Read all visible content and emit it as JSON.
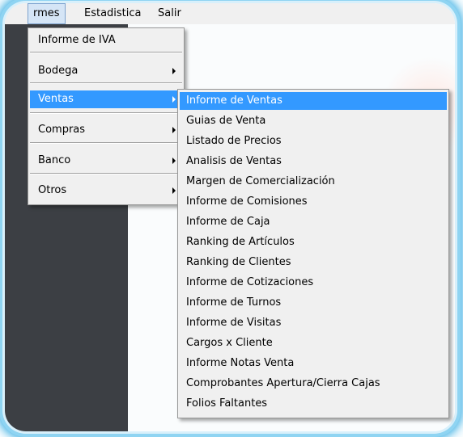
{
  "menubar": {
    "items": [
      "rmes",
      "Estadistica",
      "Salir"
    ]
  },
  "main_menu": {
    "items": [
      {
        "label": "Informe de IVA",
        "submenu": false
      },
      {
        "label": "Bodega",
        "submenu": true
      },
      {
        "label": "Ventas",
        "submenu": true,
        "highlighted": true
      },
      {
        "label": "Compras",
        "submenu": true
      },
      {
        "label": "Banco",
        "submenu": true
      },
      {
        "label": "Otros",
        "submenu": true
      }
    ]
  },
  "submenu": {
    "items": [
      {
        "label": "Informe de Ventas",
        "highlighted": true
      },
      {
        "label": "Guias de Venta"
      },
      {
        "label": "Listado de Precios"
      },
      {
        "label": "Analisis de Ventas"
      },
      {
        "label": "Margen de Comercialización"
      },
      {
        "label": "Informe de Comisiones"
      },
      {
        "label": "Informe de Caja"
      },
      {
        "label": "Ranking de Artículos"
      },
      {
        "label": "Ranking de Clientes"
      },
      {
        "label": "Informe de Cotizaciones"
      },
      {
        "label": "Informe de Turnos"
      },
      {
        "label": "Informe de Visitas"
      },
      {
        "label": "Cargos x Cliente"
      },
      {
        "label": "Informe Notas Venta"
      },
      {
        "label": "Comprobantes Apertura/Cierra Cajas"
      },
      {
        "label": "Folios Faltantes"
      }
    ]
  },
  "colors": {
    "highlight": "#3399ff",
    "frame_glow": "#4bb5e6",
    "menu_bg": "#f0f0f0",
    "dark_panel": "#3c3f44"
  }
}
